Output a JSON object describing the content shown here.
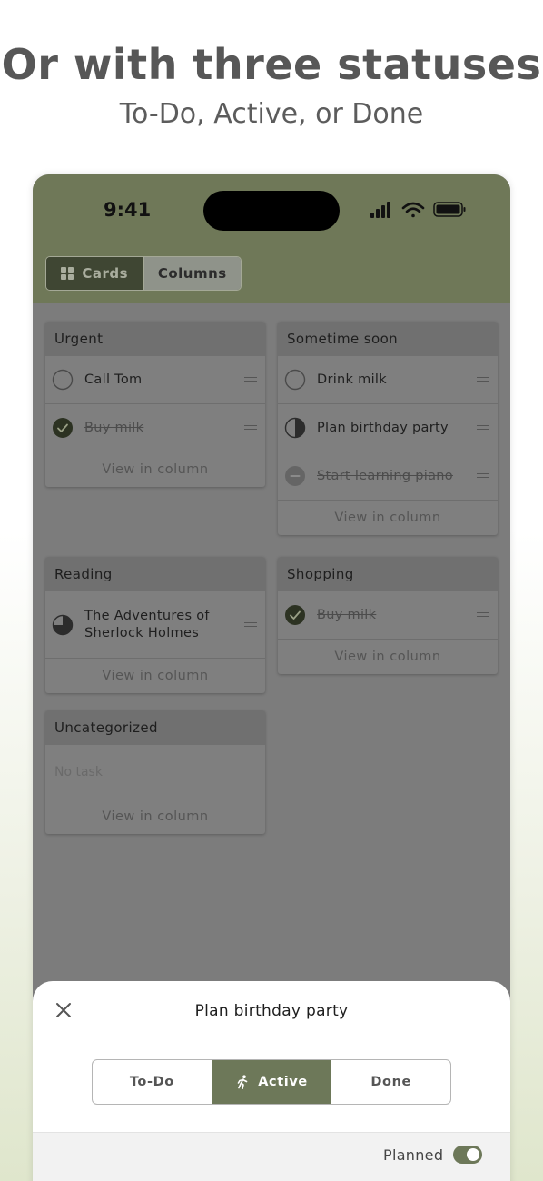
{
  "promo": {
    "headline": "Or with three statuses",
    "subline": "To-Do, Active, or Done"
  },
  "status_bar": {
    "time": "9:41"
  },
  "view_toggle": {
    "cards_label": "Cards",
    "columns_label": "Columns",
    "selected": "Cards"
  },
  "categories": [
    {
      "name": "Urgent",
      "tasks": [
        {
          "text": "Call Tom",
          "status": "todo"
        },
        {
          "text": "Buy milk",
          "status": "done"
        }
      ],
      "view_label": "View in column"
    },
    {
      "name": "Sometime soon",
      "tasks": [
        {
          "text": "Drink milk",
          "status": "todo"
        },
        {
          "text": "Plan birthday party",
          "status": "active"
        },
        {
          "text": "Start learning piano",
          "status": "cancelled"
        }
      ],
      "view_label": "View in column"
    },
    {
      "name": "Reading",
      "tasks": [
        {
          "text_line1": "The Adventures of",
          "text_line2": "Sherlock Holmes",
          "status": "progress"
        }
      ],
      "view_label": "View in column"
    },
    {
      "name": "Shopping",
      "tasks": [
        {
          "text": "Buy milk",
          "status": "done"
        }
      ],
      "view_label": "View in column"
    },
    {
      "name": "Uncategorized",
      "empty_label": "No task",
      "view_label": "View in column"
    }
  ],
  "sheet": {
    "title": "Plan birthday party",
    "statuses": [
      "To-Do",
      "Active",
      "Done"
    ],
    "selected_status": "Active",
    "planned_label": "Planned",
    "planned_on": true
  },
  "colors": {
    "accent": "#6d7859",
    "topbar": "#6f7858",
    "dimmed_background": "#7c7c7c"
  }
}
